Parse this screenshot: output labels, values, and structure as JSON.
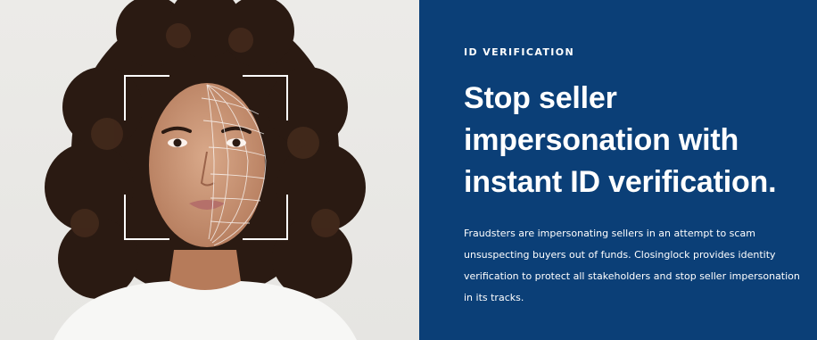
{
  "image": {
    "subject_icon": "portrait-face-scan"
  },
  "content": {
    "eyebrow": "ID VERIFICATION",
    "headline": "Stop seller impersonation with instant ID verification.",
    "body": "Fraudsters are impersonating sellers in an attempt to scam unsuspecting buyers out of funds. Closinglock provides identity verification to protect all stakeholders and stop seller impersonation in its tracks."
  },
  "colors": {
    "panel": "#0b3f77",
    "text": "#ffffff",
    "photo_bg": "#ecebe8"
  }
}
